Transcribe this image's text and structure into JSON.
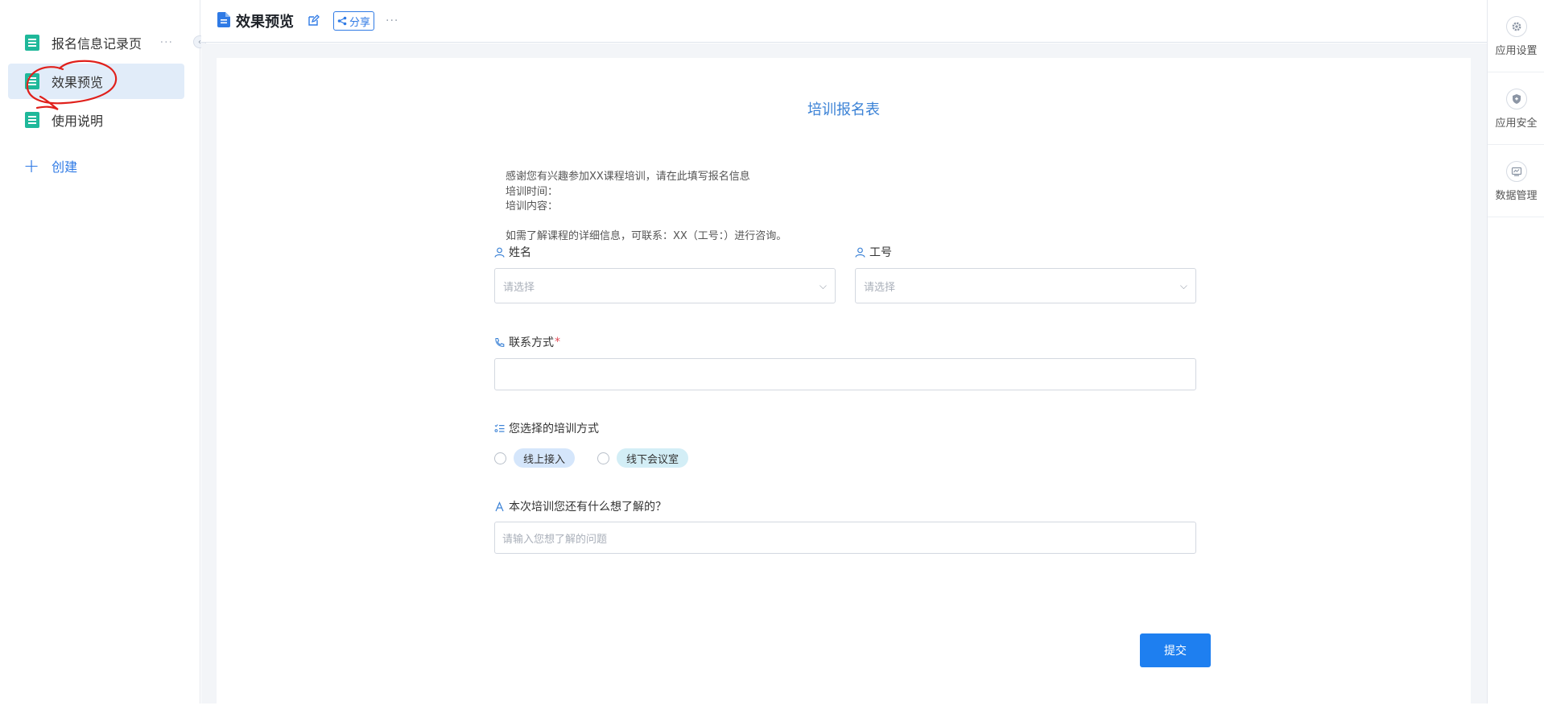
{
  "sidebar": {
    "items": [
      {
        "label": "报名信息记录页",
        "more": "···"
      },
      {
        "label": "效果预览"
      },
      {
        "label": "使用说明"
      }
    ],
    "create_label": "创建",
    "collapse_glyph": "‹"
  },
  "header": {
    "title": "效果预览",
    "share_label": "分享",
    "more": "···"
  },
  "form": {
    "title": "培训报名表",
    "intro_lines": [
      "感谢您有兴趣参加XX课程培训，请在此填写报名信息",
      "培训时间：",
      "培训内容：",
      "",
      "如需了解课程的详细信息，可联系：XX（工号：）进行咨询。"
    ],
    "name_label": "姓名",
    "name_placeholder": "请选择",
    "id_label": "工号",
    "id_placeholder": "请选择",
    "contact_label": "联系方式",
    "contact_required": "*",
    "contact_value": "",
    "method_label": "您选择的培训方式",
    "method_options": [
      "线上接入",
      "线下会议室"
    ],
    "question_label": "本次培训您还有什么想了解的？",
    "question_placeholder": "请输入您想了解的问题",
    "submit_label": "提交"
  },
  "right_panel": {
    "items": [
      {
        "label": "应用设置",
        "icon": "gear-icon"
      },
      {
        "label": "应用安全",
        "icon": "shield-icon"
      },
      {
        "label": "数据管理",
        "icon": "data-icon"
      }
    ]
  },
  "colors": {
    "accent": "#2f7ae5",
    "submit": "#1e7ff0",
    "doc_icon": "#1fb89a",
    "active_bg": "#e1ecf9",
    "tag_online": "#d5e6fb",
    "tag_offline": "#d3eef6",
    "annotation": "#e0201b"
  }
}
